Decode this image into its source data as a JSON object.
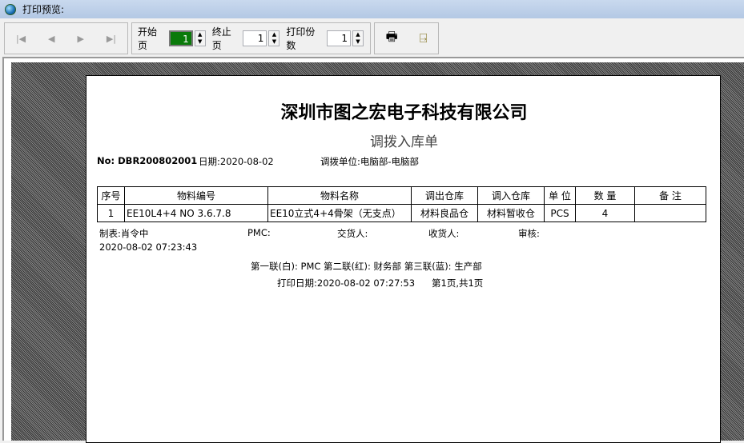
{
  "window": {
    "title": "打印预览:"
  },
  "toolbar": {
    "nav": [
      "first-page",
      "prev-page",
      "next-page",
      "last-page"
    ],
    "start_label": "开始页",
    "start_value": "1",
    "end_label": "终止页",
    "end_value": "1",
    "copies_label": "打印份数",
    "copies_value": "1"
  },
  "doc": {
    "company": "深圳市图之宏电子科技有限公司",
    "title": "调拨入库单",
    "no": "No: DBR200802001",
    "date": "日期:2020-08-02",
    "unit": "调拨单位:电脑部-电脑部",
    "headers": [
      "序号",
      "物料编号",
      "物料名称",
      "调出仓库",
      "调入仓库",
      "单 位",
      "数 量",
      "备 注"
    ],
    "rows": [
      [
        "1",
        "EE10L4+4 NO 3.6.7.8",
        "EE10立式4+4骨架（无支点）",
        "材料良品仓",
        "材料暂收仓",
        "PCS",
        "4",
        ""
      ]
    ],
    "maker": "制表:肖令中",
    "pmc": "PMC:",
    "deliverer": "交货人:",
    "receiver": "收货人:",
    "auditor": "审核:",
    "made_time": "2020-08-02 07:23:43",
    "copies_note": "第一联(白): PMC  第二联(红): 财务部    第三联(蓝): 生产部",
    "print_date": "打印日期:2020-08-02 07:27:53",
    "page_info": "第1页,共1页"
  }
}
